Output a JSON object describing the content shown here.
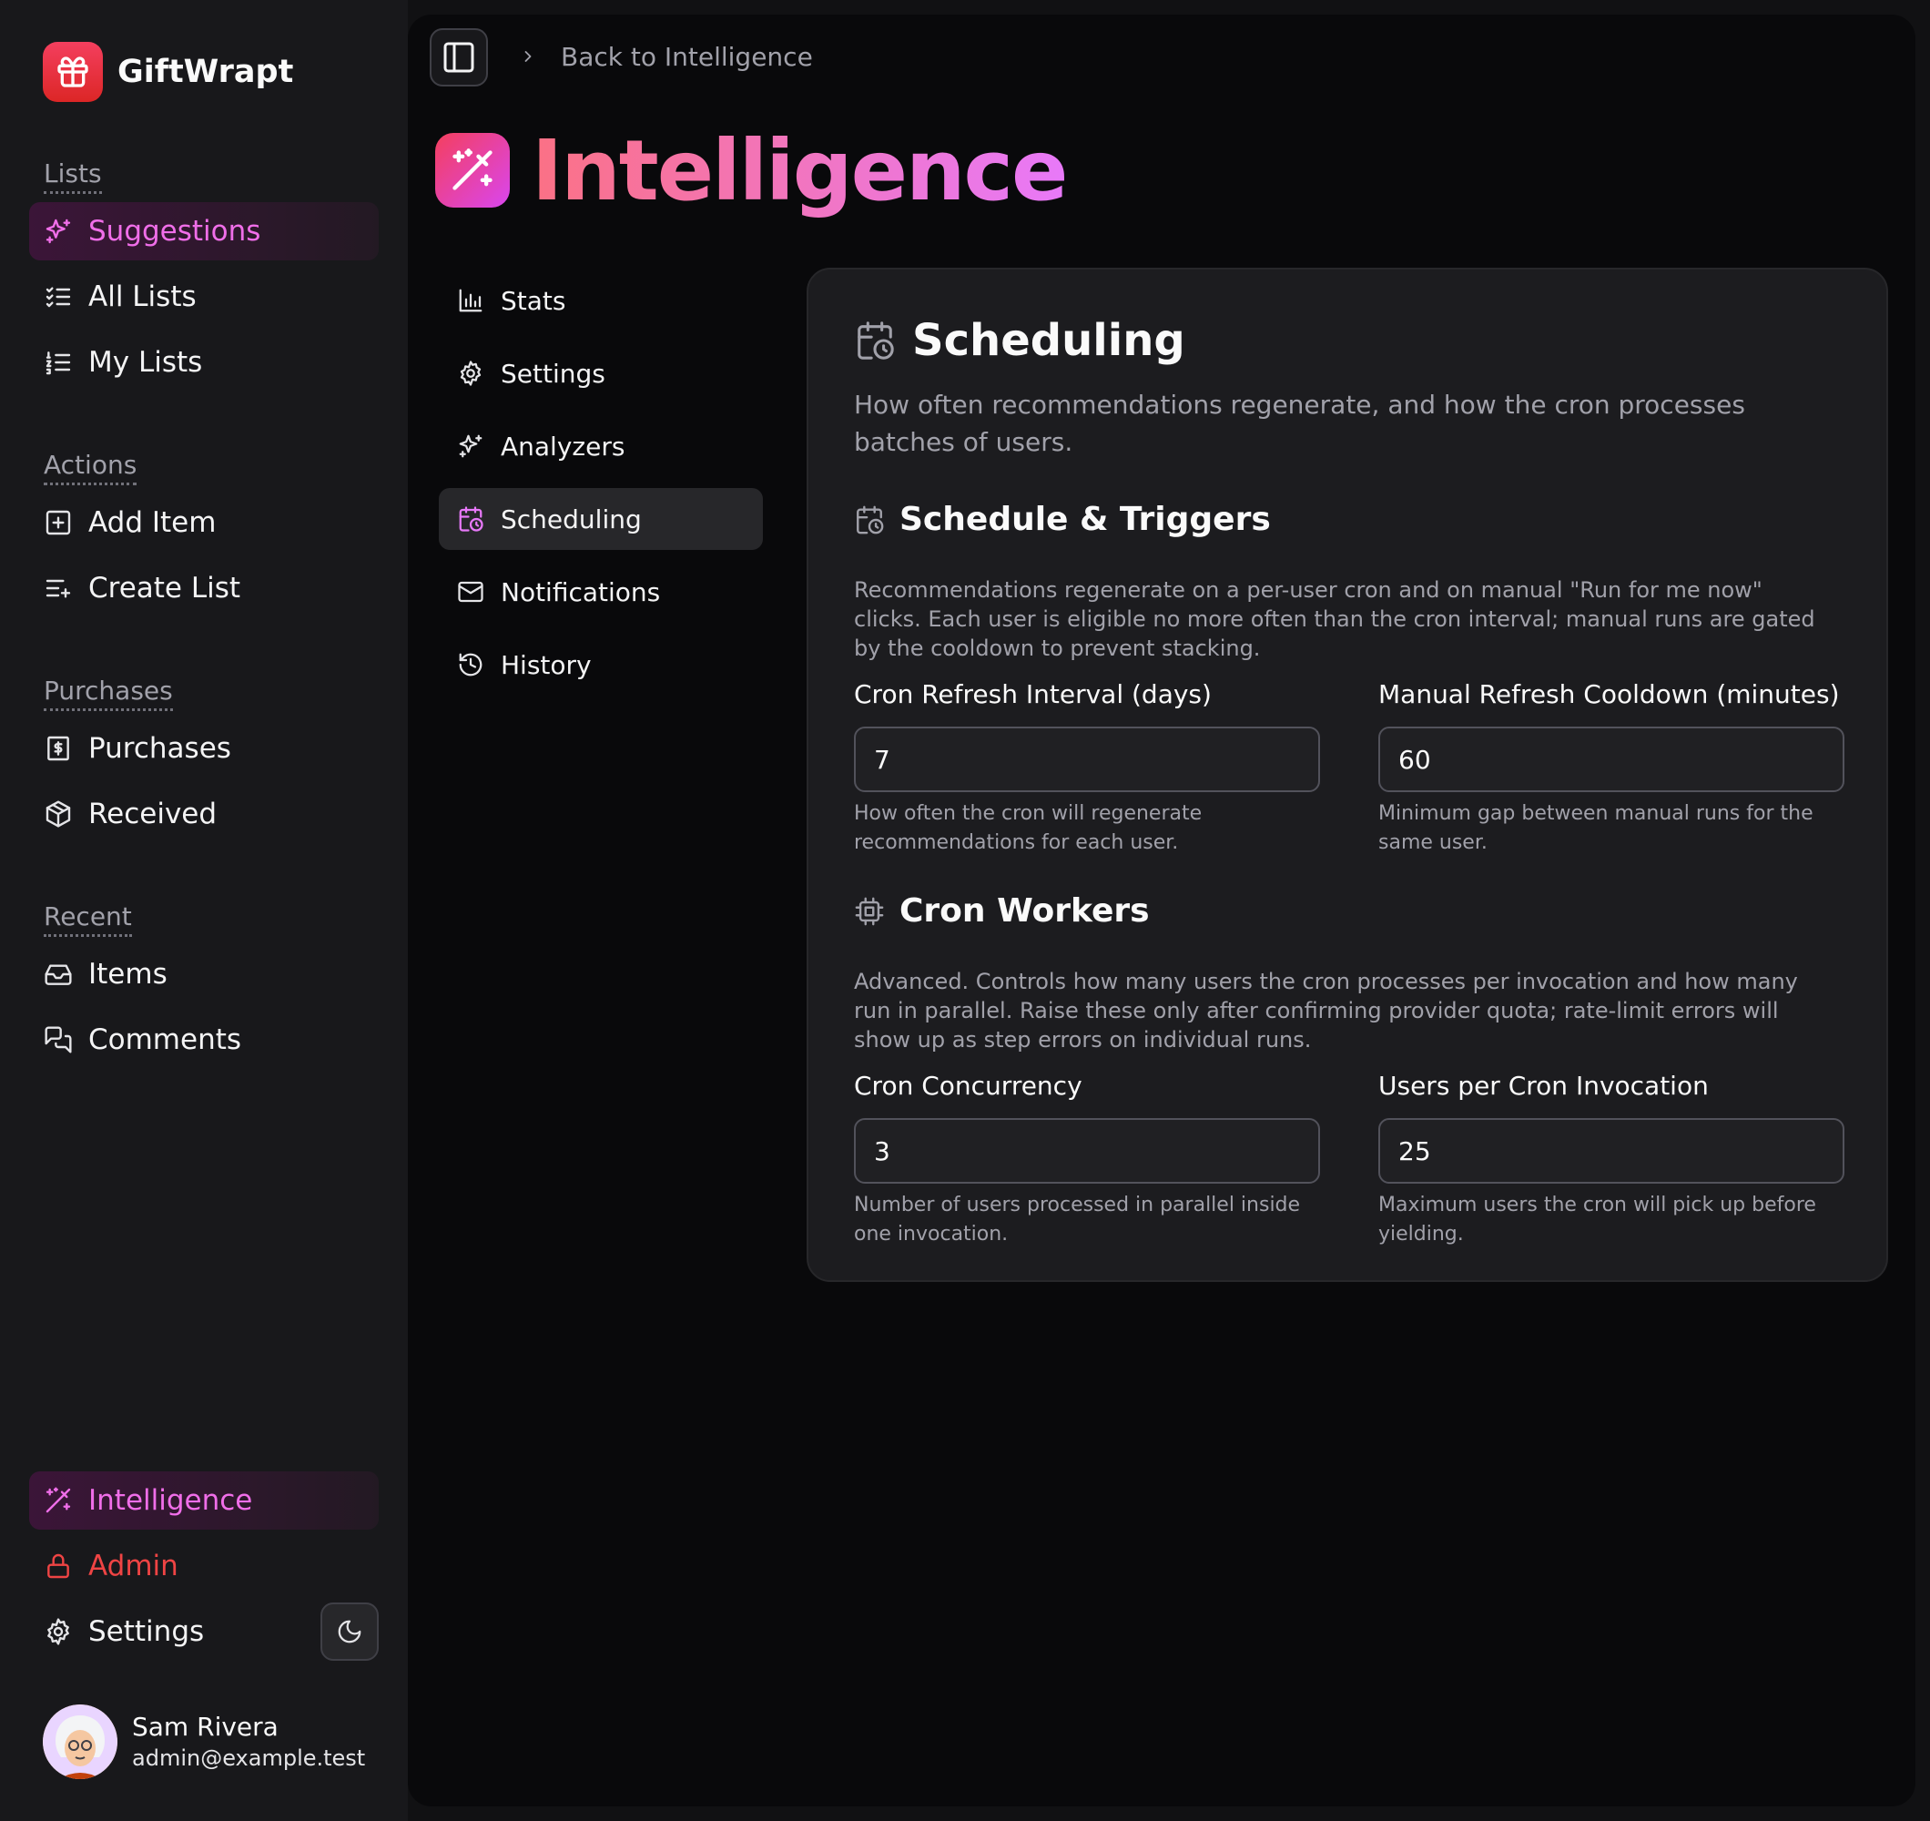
{
  "brand": {
    "name": "GiftWrapt"
  },
  "sidebar": {
    "groups": [
      {
        "label": "Lists",
        "items": [
          {
            "label": "Suggestions",
            "icon": "sparkles-icon",
            "active": true
          },
          {
            "label": "All Lists",
            "icon": "list-checks-icon"
          },
          {
            "label": "My Lists",
            "icon": "list-ordered-icon"
          }
        ]
      },
      {
        "label": "Actions",
        "items": [
          {
            "label": "Add Item",
            "icon": "plus-square-icon"
          },
          {
            "label": "Create List",
            "icon": "list-plus-icon"
          }
        ]
      },
      {
        "label": "Purchases",
        "items": [
          {
            "label": "Purchases",
            "icon": "receipt-icon"
          },
          {
            "label": "Received",
            "icon": "package-icon"
          }
        ]
      },
      {
        "label": "Recent",
        "items": [
          {
            "label": "Items",
            "icon": "inbox-icon"
          },
          {
            "label": "Comments",
            "icon": "messages-icon"
          }
        ]
      }
    ],
    "bottom": {
      "intelligence": "Intelligence",
      "admin": "Admin",
      "settings": "Settings"
    },
    "user": {
      "name": "Sam Rivera",
      "email": "admin@example.test"
    }
  },
  "header": {
    "breadcrumb": "Back to Intelligence"
  },
  "page": {
    "title": "Intelligence"
  },
  "subnav": {
    "items": [
      {
        "label": "Stats",
        "icon": "bar-chart-icon"
      },
      {
        "label": "Settings",
        "icon": "gear-icon"
      },
      {
        "label": "Analyzers",
        "icon": "sparkles-icon"
      },
      {
        "label": "Scheduling",
        "icon": "calendar-clock-icon",
        "active": true
      },
      {
        "label": "Notifications",
        "icon": "mail-icon"
      },
      {
        "label": "History",
        "icon": "history-icon"
      }
    ]
  },
  "card": {
    "title": "Scheduling",
    "description": "How often recommendations regenerate, and how the cron processes batches of users.",
    "sections": [
      {
        "title": "Schedule & Triggers",
        "icon": "calendar-clock-icon",
        "description": "Recommendations regenerate on a per-user cron and on manual \"Run for me now\" clicks. Each user is eligible no more often than the cron interval; manual runs are gated by the cooldown to prevent stacking.",
        "fields": [
          {
            "label": "Cron Refresh Interval (days)",
            "value": "7",
            "help": "How often the cron will regenerate recommendations for each user."
          },
          {
            "label": "Manual Refresh Cooldown (minutes)",
            "value": "60",
            "help": "Minimum gap between manual runs for the same user."
          }
        ]
      },
      {
        "title": "Cron Workers",
        "icon": "cpu-icon",
        "description": "Advanced. Controls how many users the cron processes per invocation and how many run in parallel. Raise these only after confirming provider quota; rate-limit errors will show up as step errors on individual runs.",
        "fields": [
          {
            "label": "Cron Concurrency",
            "value": "3",
            "help": "Number of users processed in parallel inside one invocation."
          },
          {
            "label": "Users per Cron Invocation",
            "value": "25",
            "help": "Maximum users the cron will pick up before yielding."
          }
        ]
      }
    ]
  },
  "colors": {
    "accent": "#f06ee9",
    "danger": "#ef4444",
    "brand": "#dc2626",
    "background": "#09090b"
  }
}
